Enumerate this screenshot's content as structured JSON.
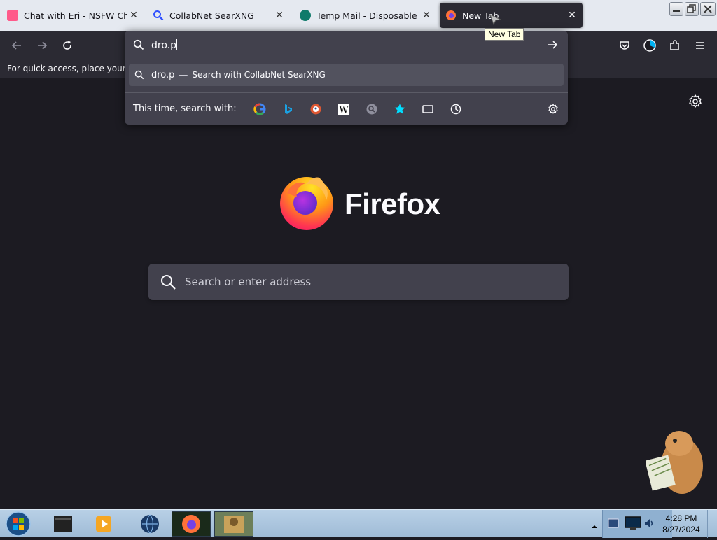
{
  "tabs": [
    {
      "title": "Chat with Eri - NSFW Charac",
      "favicon_color": "#ff5a8a",
      "favicon": "bunny-icon"
    },
    {
      "title": "CollabNet SearXNG",
      "favicon_color": "#3050ff",
      "favicon": "magnifier-icon"
    },
    {
      "title": "Temp Mail - Disposable Tem",
      "favicon_color": "#0f7a6a",
      "favicon": "globe-icon"
    },
    {
      "title": "New Tab",
      "favicon_color": "#ff7139",
      "favicon": "firefox-icon"
    }
  ],
  "tooltip": "New Tab",
  "bookmarks_hint": "For quick access, place your boo",
  "urlbar": {
    "value": "dro.p",
    "suggestion": {
      "query": "dro.p",
      "separator": "—",
      "action": "Search with CollabNet SearXNG"
    },
    "oneoff_label": "This time, search with:",
    "engines": [
      "google-icon",
      "bing-icon",
      "duckduckgo-icon",
      "wikipedia-icon",
      "searxng-icon",
      "bookmarks-star-icon",
      "tabs-icon",
      "history-icon"
    ]
  },
  "content": {
    "brand": "Firefox",
    "search_placeholder": "Search or enter address"
  },
  "taskbar": {
    "time": "4:28 PM",
    "date": "8/27/2024"
  },
  "colors": {
    "accent": "#ff7139",
    "toolbar": "#2b2a33",
    "page": "#1c1b22"
  }
}
